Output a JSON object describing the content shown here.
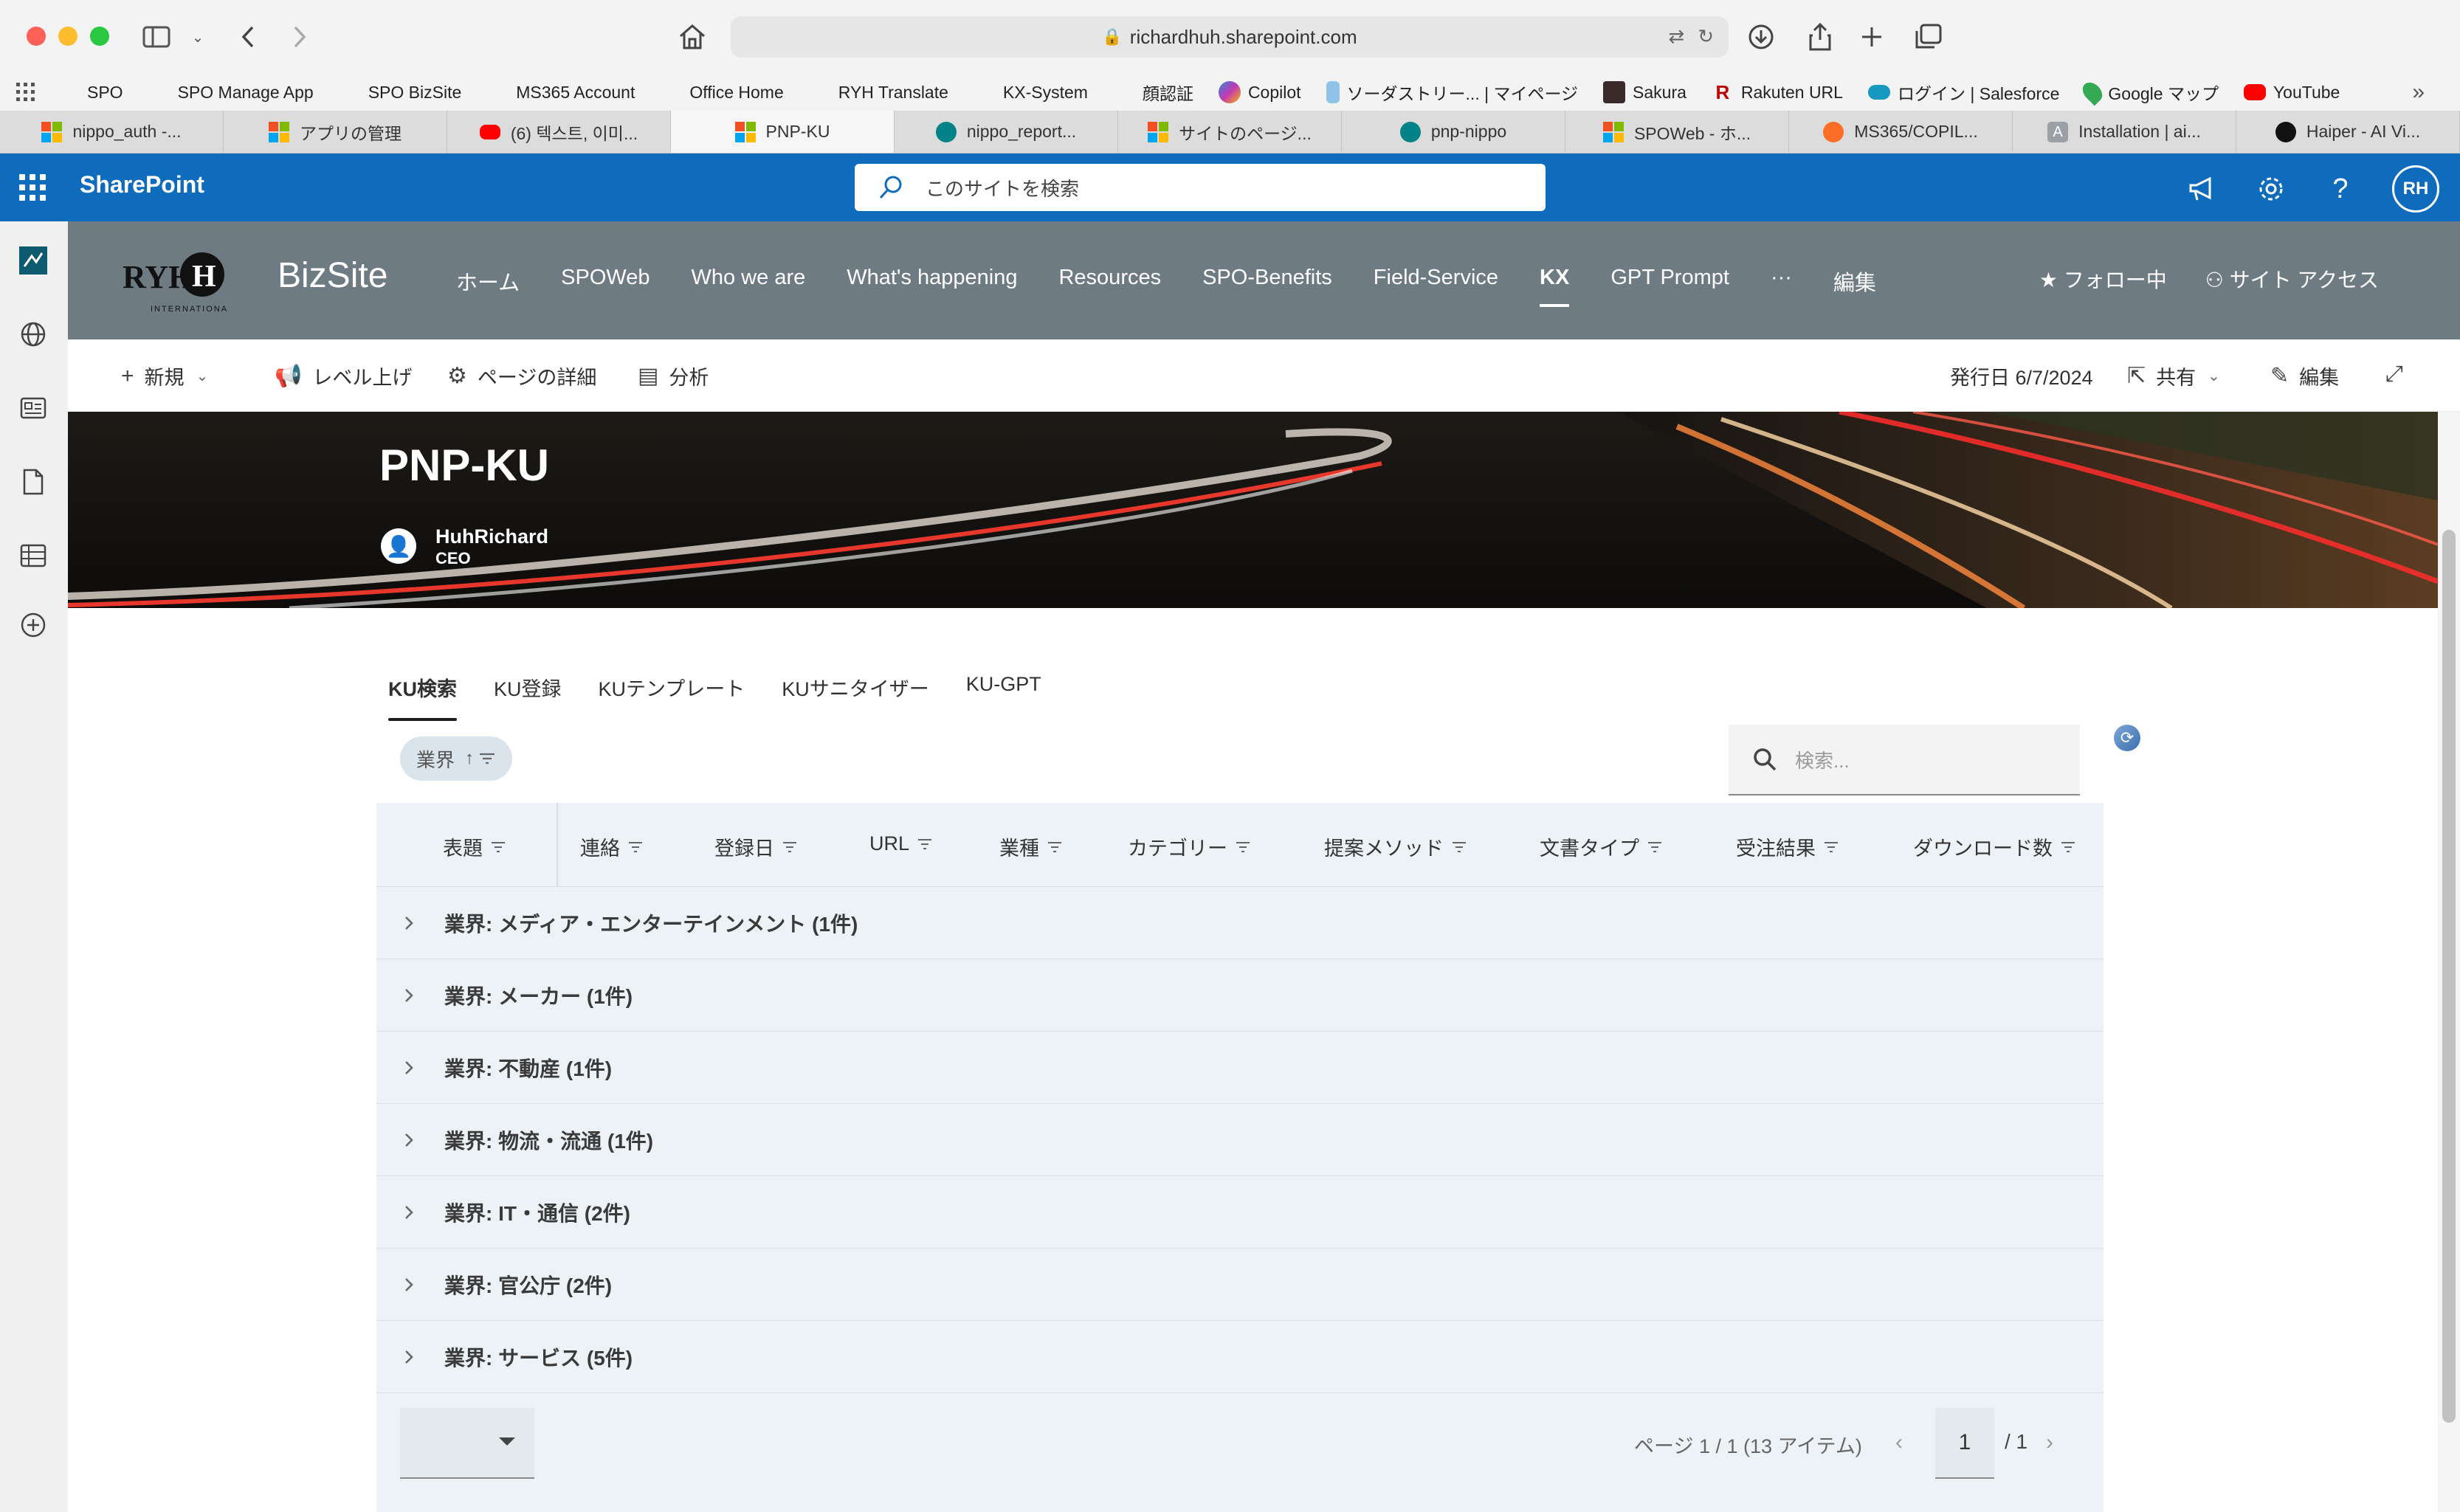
{
  "browser": {
    "url": "richardhuh.sharepoint.com",
    "bookmarks": [
      "SPO",
      "SPO Manage App",
      "SPO BizSite",
      "MS365 Account",
      "Office Home",
      "RYH Translate",
      "KX-System",
      "顔認証",
      "Copilot",
      "ソーダストリー... | マイページ",
      "Sakura",
      "Rakuten URL",
      "ログイン | Salesforce",
      "Google マップ",
      "YouTube"
    ],
    "tabs": [
      "nippo_auth -...",
      "アプリの管理",
      "(6) 텍스트, 이미...",
      "PNP-KU",
      "nippo_report...",
      "サイトのページ...",
      "pnp-nippo",
      "SPOWeb - ホ...",
      "MS365/COPIL...",
      "Installation | ai...",
      "Haiper - AI Vi..."
    ]
  },
  "suite": {
    "app_name": "SharePoint",
    "search_placeholder": "このサイトを検索",
    "avatar_initials": "RH"
  },
  "site": {
    "name": "BizSite",
    "logo_text": "RYH",
    "logo_sub": "INTERNATIONAL",
    "nav": [
      "ホーム",
      "SPOWeb",
      "Who we are",
      "What's happening",
      "Resources",
      "SPO-Benefits",
      "Field-Service",
      "KX",
      "GPT Prompt",
      "···",
      "編集"
    ],
    "follow": "フォロー中",
    "site_access": "サイト アクセス"
  },
  "command_bar": {
    "new": "新規",
    "promote": "レベル上げ",
    "page_details": "ページの詳細",
    "analytics": "分析",
    "published": "発行日 6/7/2024",
    "share": "共有",
    "edit": "編集"
  },
  "page": {
    "title": "PNP-KU",
    "author_name": "HuhRichard",
    "author_role": "CEO",
    "pivots": [
      "KU検索",
      "KU登録",
      "KUテンプレート",
      "KUサニタイザー",
      "KU-GPT"
    ],
    "group_chip": "業界",
    "search_placeholder": "検索...",
    "columns": [
      "表題",
      "連絡",
      "登録日",
      "URL",
      "業種",
      "カテゴリー",
      "提案メソッド",
      "文書タイプ",
      "受注結果",
      "ダウンロード数"
    ],
    "groups": [
      "業界: メディア・エンターテインメント (1件)",
      "業界: メーカー (1件)",
      "業界: 不動産 (1件)",
      "業界: 物流・流通 (1件)",
      "業界: IT・通信 (2件)",
      "業界: 官公庁 (2件)",
      "業界: サービス (5件)"
    ],
    "page_info": "ページ 1 / 1 (13 アイテム)",
    "page_number": "1",
    "page_total": "/ 1"
  },
  "colors": {
    "suite_blue": "#0f6cbd",
    "header_gray": "#6f7b82",
    "grid_bg": "#edf2f6"
  }
}
